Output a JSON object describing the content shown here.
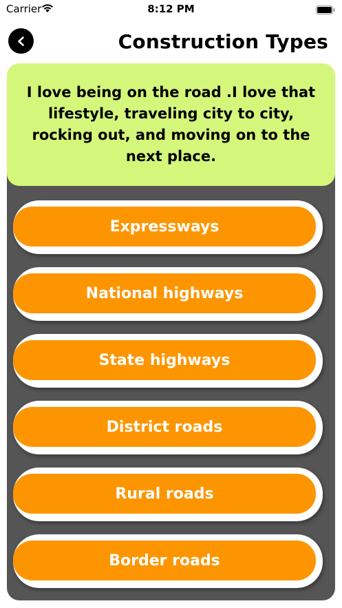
{
  "status_bar": {
    "carrier": "Carrier",
    "time": "8:12 PM",
    "wifi_icon": "wifi-icon",
    "battery_icon": "battery-icon"
  },
  "header": {
    "back_icon": "chevron-left-icon",
    "title": "Construction Types"
  },
  "quote": {
    "text": "I love being on the road .I love that lifestyle, traveling city to city, rocking out, and moving on to the next place."
  },
  "options": [
    {
      "label": "Expressways"
    },
    {
      "label": "National highways"
    },
    {
      "label": "State highways"
    },
    {
      "label": "District roads"
    },
    {
      "label": "Rural roads"
    },
    {
      "label": "Border roads"
    }
  ],
  "colors": {
    "quote_background": "#d4f77b",
    "panel_background": "#555555",
    "option_background": "#fd9500",
    "option_text": "#ffffff"
  }
}
